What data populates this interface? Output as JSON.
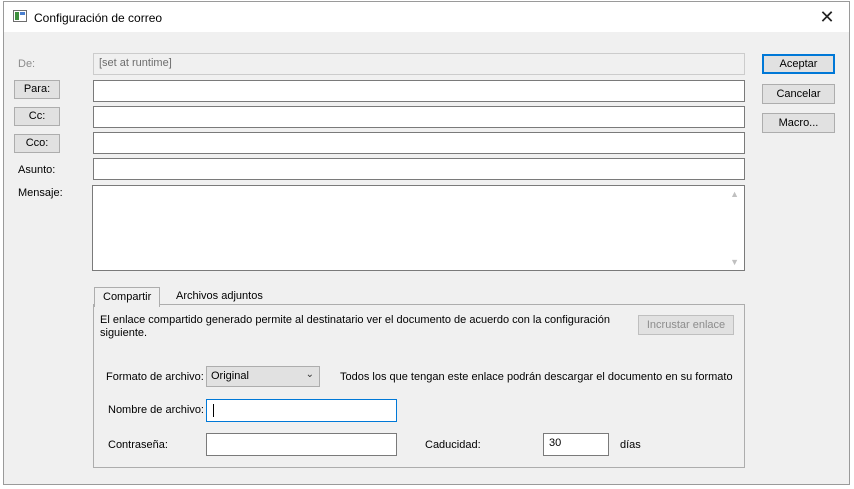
{
  "window": {
    "title": "Configuración de correo",
    "close_glyph": "✕"
  },
  "form": {
    "from_label": "De:",
    "from_value": "[set at runtime]",
    "to_button": "Para:",
    "cc_button": "Cc:",
    "bcc_button": "Cco:",
    "subject_label": "Asunto:",
    "message_label": "Mensaje:"
  },
  "buttons": {
    "accept": "Aceptar",
    "cancel": "Cancelar",
    "macro": "Macro..."
  },
  "tabs": {
    "share": "Compartir",
    "attachments": "Archivos adjuntos"
  },
  "share": {
    "description": "El enlace compartido generado permite al destinatario ver el documento de acuerdo con la configuración siguiente.",
    "embed_button": "Incrustar enlace",
    "format_label": "Formato de archivo:",
    "format_value": "Original",
    "format_note": "Todos los que tengan este enlace podrán descargar el documento en su formato",
    "filename_label": "Nombre de archivo:",
    "password_label": "Contraseña:",
    "expiry_label": "Caducidad:",
    "expiry_value": "30",
    "expiry_unit": "días"
  },
  "icons": {
    "app": "mail-config-icon",
    "close": "close-icon",
    "chevron": "chevron-down-icon"
  }
}
